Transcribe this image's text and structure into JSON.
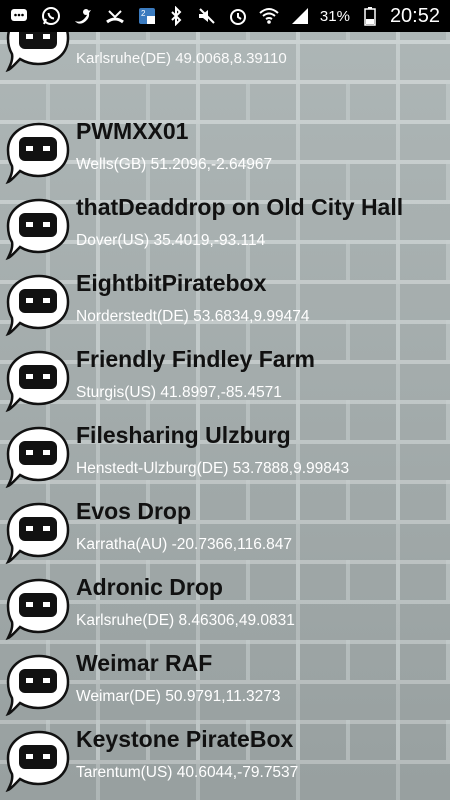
{
  "status_bar": {
    "icons_left": [
      "chat-bubble-icon",
      "whatsapp-icon",
      "twitter-icon",
      "missed-call-icon",
      "app-notification-icon"
    ],
    "icons_right": [
      "bluetooth-icon",
      "mute-icon",
      "alarm-icon",
      "wifi-icon",
      "signal-icon",
      "battery-icon"
    ],
    "battery": "31%",
    "time": "20:52"
  },
  "partial_item": {
    "subtitle": "Karlsruhe(DE) 49.0068,8.39110"
  },
  "items": [
    {
      "title": "PWMXX01",
      "subtitle": "Wells(GB) 51.2096,-2.64967"
    },
    {
      "title": "thatDeaddrop on Old City Hall",
      "subtitle": "Dover(US) 35.4019,-93.114"
    },
    {
      "title": "EightbitPiratebox",
      "subtitle": "Norderstedt(DE) 53.6834,9.99474"
    },
    {
      "title": "Friendly Findley Farm",
      "subtitle": "Sturgis(US) 41.8997,-85.4571"
    },
    {
      "title": "Filesharing Ulzburg",
      "subtitle": "Henstedt-Ulzburg(DE) 53.7888,9.99843"
    },
    {
      "title": "Evos Drop",
      "subtitle": "Karratha(AU) -20.7366,116.847"
    },
    {
      "title": "Adronic Drop",
      "subtitle": "Karlsruhe(DE) 8.46306,49.0831"
    },
    {
      "title": "Weimar RAF",
      "subtitle": "Weimar(DE) 50.9791,11.3273"
    },
    {
      "title": "Keystone PirateBox",
      "subtitle": "Tarentum(US) 40.6044,-79.7537"
    }
  ]
}
